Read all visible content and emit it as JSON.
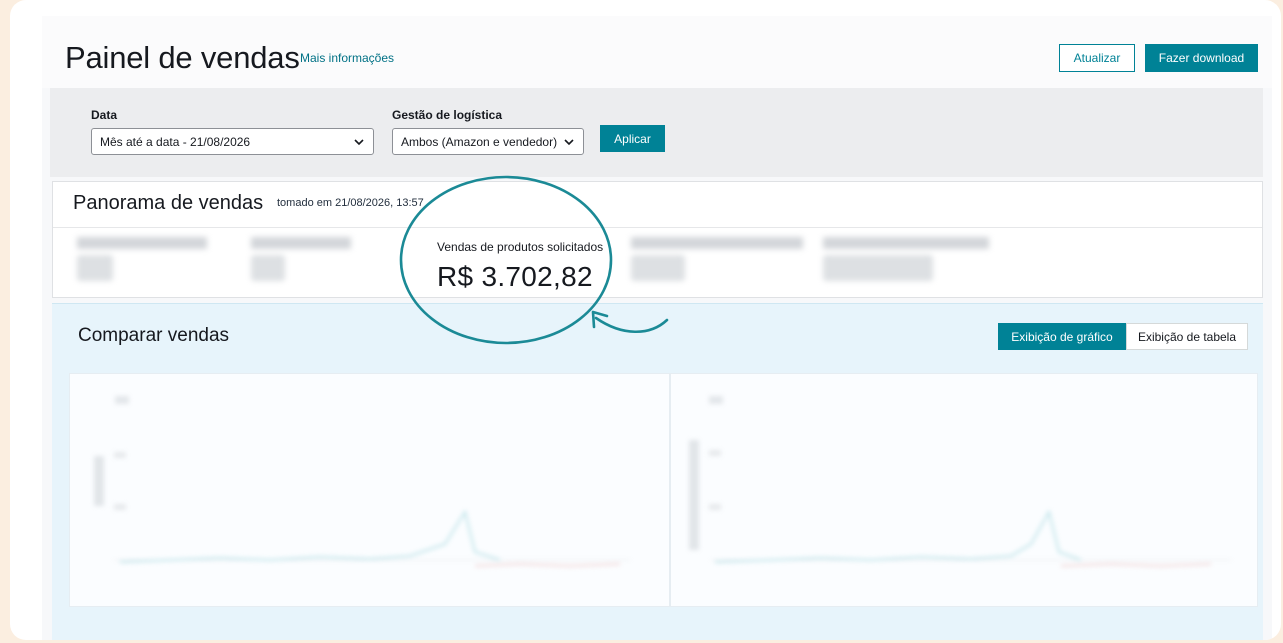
{
  "header": {
    "title": "Painel de vendas",
    "more_info": "Mais informações",
    "refresh_label": "Atualizar",
    "download_label": "Fazer download"
  },
  "filters": {
    "date_label": "Data",
    "date_value": "Mês até a data - 21/08/2026",
    "logistics_label": "Gestão de logística",
    "logistics_value": "Ambos (Amazon e vendedor)",
    "apply_label": "Aplicar"
  },
  "overview": {
    "title": "Panorama de vendas",
    "timestamp": "tomado em 21/08/2026, 13:57",
    "highlight_metric": {
      "label": "Vendas de produtos solicitados",
      "value": "R$ 3.702,82"
    }
  },
  "compare": {
    "title": "Comparar vendas",
    "chart_view_label": "Exibição de gráfico",
    "table_view_label": "Exibição de tabela"
  },
  "colors": {
    "accent": "#008296",
    "annotation": "#1b8a96",
    "background": "#fbeee0"
  }
}
